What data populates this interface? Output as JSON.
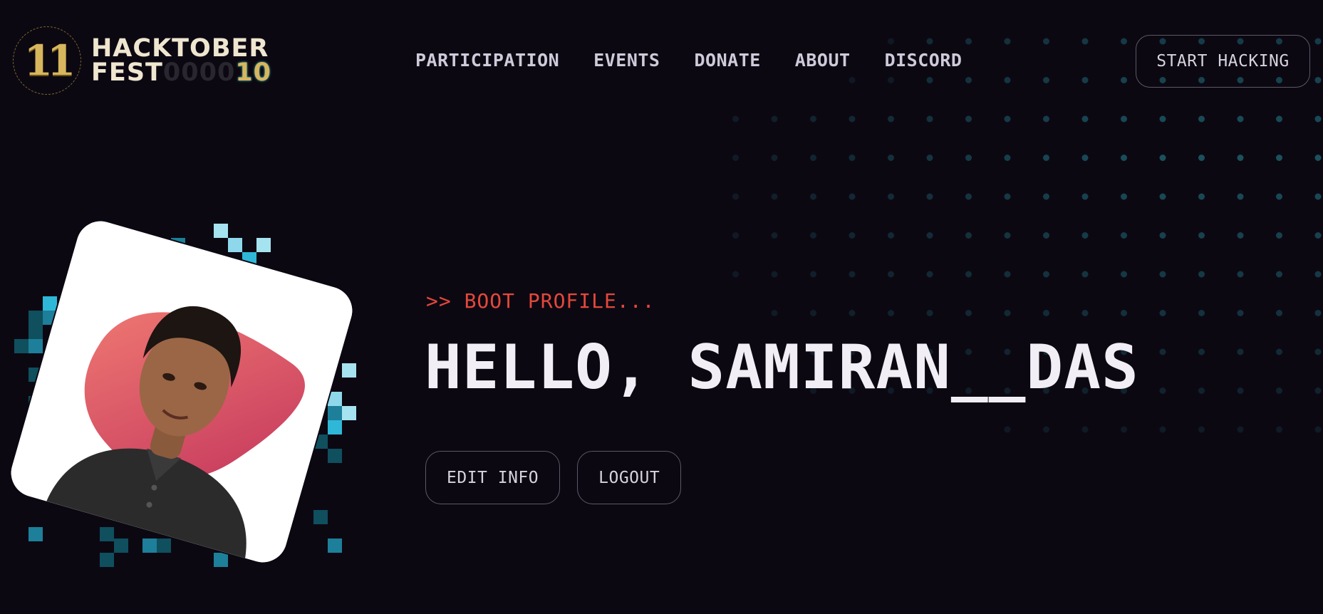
{
  "colors": {
    "background": "#0c0812",
    "accent_red": "#e4483b",
    "gold": "#d7b65e",
    "teal": "#2ec4c4",
    "text": "#f1eef6"
  },
  "logo": {
    "badge_text": "11",
    "line1": "HACKTOBER",
    "line2": "FEST",
    "line2_suffix": "0000",
    "line2_number": "10"
  },
  "nav": {
    "items": [
      {
        "label": "PARTICIPATION"
      },
      {
        "label": "EVENTS"
      },
      {
        "label": "DONATE"
      },
      {
        "label": "ABOUT"
      },
      {
        "label": "DISCORD"
      }
    ],
    "cta_label": "START HACKING"
  },
  "profile": {
    "boot_text": ">> BOOT PROFILE...",
    "greeting": "HELLO, SAMIRAN__DAS",
    "edit_label": "EDIT INFO",
    "logout_label": "LOGOUT",
    "avatar_icon": "user-photo"
  }
}
